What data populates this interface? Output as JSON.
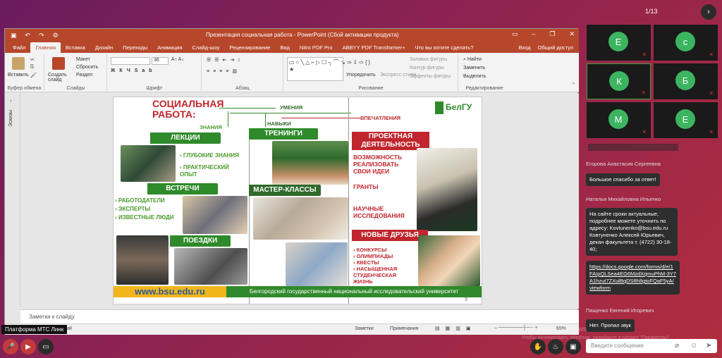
{
  "meeting": {
    "page_counter": "1/13",
    "next_icon": "chevron-right-icon",
    "tooltip": "Платформа МТС Линк"
  },
  "ppt": {
    "title": "Презентация социальная работа - PowerPoint (Сбой активации продукта)",
    "tabs": [
      "Файл",
      "Главная",
      "Вставка",
      "Дизайн",
      "Переходы",
      "Анимация",
      "Слайд-шоу",
      "Рецензирование",
      "Вид",
      "Nitro PDF Pro",
      "ABBYY PDF Transformer+",
      "Что вы хотите сделать?"
    ],
    "active_tab": "Главная",
    "signin": "Вход",
    "share": "Общий доступ",
    "ribbon": {
      "paste": "Вставить",
      "clipboard_group": "Буфер обмена",
      "new_slide": "Создать слайд",
      "layout": "Макет",
      "reset": "Сбросить",
      "section": "Раздел",
      "slides_group": "Слайды",
      "font_size": "36",
      "font_group": "Шрифт",
      "paragraph_group": "Абзац",
      "arrange": "Упорядочить",
      "quick_styles": "Экспресс-стили",
      "fill": "Заливка фигуры",
      "outline": "Контур фигуры",
      "effects": "Эффекты фигуры",
      "drawing_group": "Рисование",
      "find": "Найти",
      "replace": "Заменить",
      "select": "Выделить",
      "editing_group": "Редактирование"
    },
    "thumbs_label": "Эскизы",
    "notes_placeholder": "Заметки к слайду",
    "status": {
      "lang": "кий",
      "notes": "Заметки",
      "comments": "Примечания",
      "zoom": "69%"
    }
  },
  "slide": {
    "title_line1": "СОЦИАЛЬНАЯ",
    "title_line2": "РАБОТА:",
    "knowledge": "ЗНАНИЯ",
    "skills": "НАВЫКИ",
    "abilities": "УМЕНИЯ",
    "impressions": "ВПЕЧАТЛЕНИЯ",
    "logo": "БелГУ",
    "lectures": "ЛЕКЦИИ",
    "lectures_items": [
      "ГЛУБОКИЕ ЗНАНИЯ",
      "ПРАКТИЧЕСКИЙ ОПЫТ"
    ],
    "trainings": "ТРЕНИНГИ",
    "projects_line1": "ПРОЕКТНАЯ",
    "projects_line2": "ДЕЯТЕЛЬНОСТЬ",
    "projects_items": [
      "ВОЗМОЖНОСТЬ РЕАЛИЗОВАТЬ СВОИ ИДЕИ",
      "ГРАНТЫ",
      "НАУЧНЫЕ ИССЛЕДОВАНИЯ"
    ],
    "meetings": "ВСТРЕЧИ",
    "meetings_items": [
      "РАБОТОДАТЕЛИ",
      "ЭКСПЕРТЫ",
      "ИЗВЕСТНЫЕ ЛЮДИ"
    ],
    "masterclasses": "МАСТЕР-КЛАССЫ",
    "trips": "ПОЕЗДКИ",
    "friends": "НОВЫЕ ДРУЗЬЯ",
    "friends_items": [
      "КОНКУРСЫ",
      "ОЛИМПИАДЫ",
      "КВЕСТЫ",
      "НАСЫЩЕННАЯ СТУДЕНЧЕСКАЯ ЖИЗНЬ"
    ],
    "url": "www.bsu.edu.ru",
    "university": "Белгородский государственный национальный исследовательский университет",
    "page_number": "9"
  },
  "participants": [
    {
      "initial": "Е",
      "muted": true,
      "active": false
    },
    {
      "initial": "с",
      "muted": true,
      "active": false
    },
    {
      "initial": "К",
      "muted": true,
      "active": true
    },
    {
      "initial": "Б",
      "muted": true,
      "active": false
    },
    {
      "initial": "М",
      "muted": true,
      "active": false
    },
    {
      "initial": "Е",
      "muted": true,
      "active": false
    }
  ],
  "chat": [
    {
      "name": "Егорова Анастасия Сергеевна",
      "text": "Большое спасибо за ответ!"
    },
    {
      "name": "Наталья Михайловна Ильенко",
      "text": "На сайте сроки актуальные, подробнее можете уточнить по адресу: Kovtunenko@bsu.edu.ru Ковтуненко Алексей Юрьевич, декан факультета т. (4722) 30-18-40;",
      "link": "https://docs.google.com/forms/d/e/1FAIpQLSea4EG6MzdXqmuPhM-3Y7A1hzut7ZXulBqDS8h8gtoFQaF5yA/viewform"
    },
    {
      "name": "Пащенко Евгений Игоревич",
      "text": "Нет. Пропал звук"
    }
  ],
  "chat_input_placeholder": "Введите сообщение",
  "watermark": {
    "line1": "Активация Windows",
    "line2": "Чтобы активировать Windows, перейдите в раздел \"Параметры\"."
  }
}
